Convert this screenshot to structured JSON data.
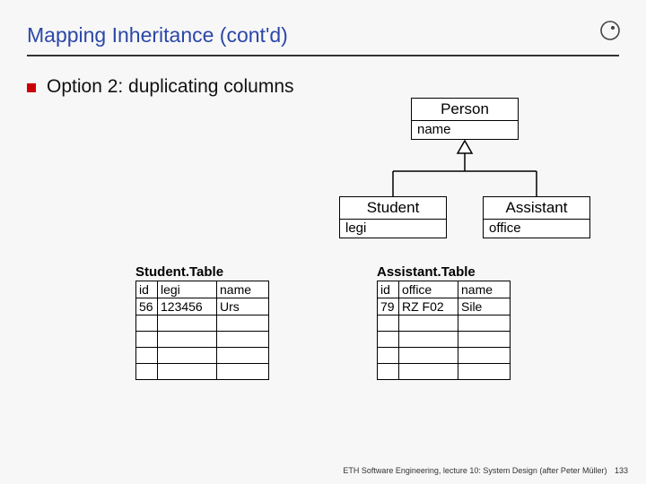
{
  "title": "Mapping Inheritance (cont'd)",
  "bullet": "Option 2: duplicating columns",
  "uml": {
    "person": {
      "name": "Person",
      "attr": "name"
    },
    "student": {
      "name": "Student",
      "attr": "legi"
    },
    "assistant": {
      "name": "Assistant",
      "attr": "office"
    }
  },
  "tables": {
    "student": {
      "title": "Student.Table",
      "headers": [
        "id",
        "legi",
        "name"
      ],
      "rows": [
        [
          "56",
          "123456",
          "Urs"
        ]
      ]
    },
    "assistant": {
      "title": "Assistant.Table",
      "headers": [
        "id",
        "office",
        "name"
      ],
      "rows": [
        [
          "79",
          "RZ F02",
          "Sile"
        ]
      ]
    }
  },
  "footer": {
    "text": "ETH Software Engineering, lecture 10: System Design (after Peter Müller)",
    "page": "133"
  }
}
